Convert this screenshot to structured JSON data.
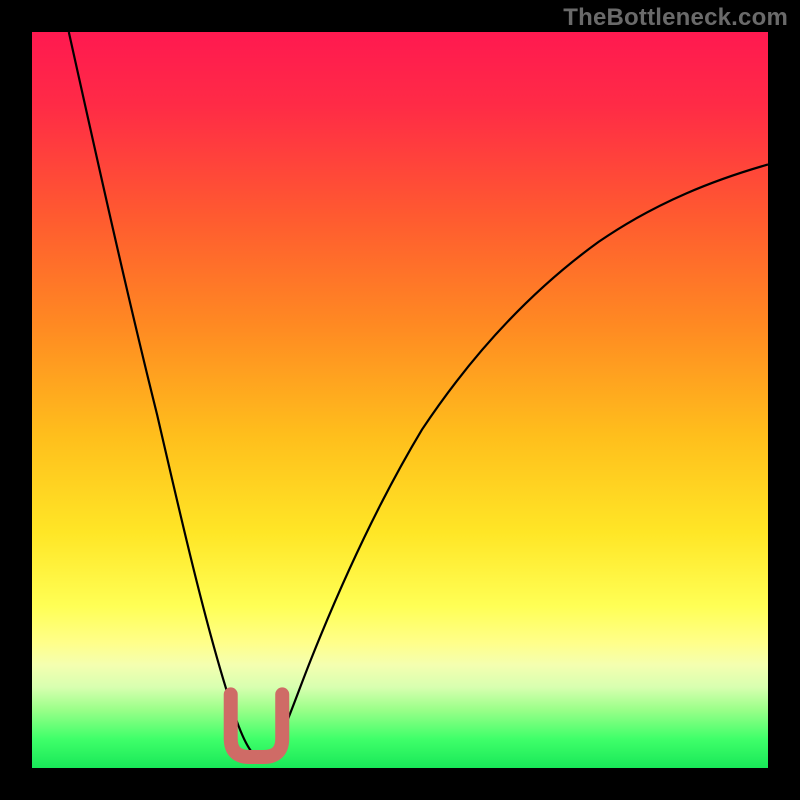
{
  "watermark": "TheBottleneck.com",
  "colors": {
    "frame_bg": "#000000",
    "gradient_top": "#ff1a4a",
    "gradient_mid1": "#ff6a2a",
    "gradient_mid2": "#ffd21a",
    "gradient_mid3": "#ffff66",
    "gradient_band": "#f6ffa0",
    "gradient_bottom": "#1fff6a",
    "curve": "#000000",
    "marker": "#cf6b66"
  },
  "chart_data": {
    "type": "line",
    "title": "",
    "xlabel": "",
    "ylabel": "",
    "xlim": [
      0,
      100
    ],
    "ylim": [
      0,
      100
    ],
    "series": [
      {
        "name": "bottleneck-curve",
        "x": [
          5,
          8,
          12,
          16,
          20,
          23,
          26,
          28,
          30,
          32,
          34,
          38,
          44,
          52,
          62,
          74,
          88,
          100
        ],
        "y": [
          100,
          82,
          64,
          47,
          32,
          20,
          11,
          5,
          2,
          2,
          5,
          14,
          28,
          43,
          57,
          68,
          77,
          82
        ]
      }
    ],
    "markers": {
      "name": "optimal-range",
      "shape": "U",
      "x_range": [
        27,
        33
      ],
      "y_range": [
        2,
        10
      ]
    },
    "gradient_bands_y": {
      "red_to_orange": [
        100,
        55
      ],
      "orange_to_yellow": [
        55,
        25
      ],
      "pale_yellow_band": [
        25,
        12
      ],
      "green_band": [
        12,
        0
      ]
    }
  }
}
